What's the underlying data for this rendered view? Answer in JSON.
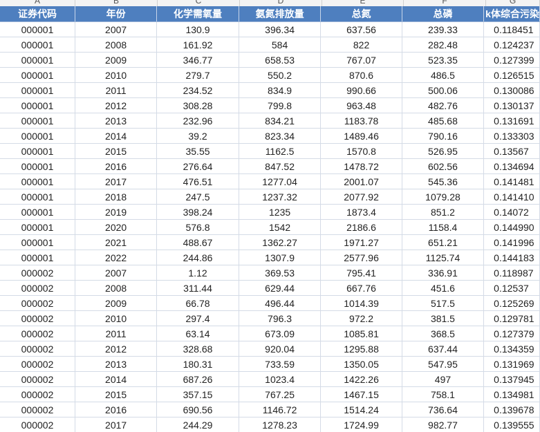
{
  "column_letters": [
    "A",
    "B",
    "C",
    "D",
    "E",
    "F",
    "G"
  ],
  "headers": [
    "证券代码",
    "年份",
    "化学需氧量",
    "氨氮排放量",
    "总氮",
    "总磷",
    "k体综合污染"
  ],
  "rows": [
    [
      "000001",
      "2007",
      "130.9",
      "396.34",
      "637.56",
      "239.33",
      "0.118451"
    ],
    [
      "000001",
      "2008",
      "161.92",
      "584",
      "822",
      "282.48",
      "0.124237"
    ],
    [
      "000001",
      "2009",
      "346.77",
      "658.53",
      "767.07",
      "523.35",
      "0.127399"
    ],
    [
      "000001",
      "2010",
      "279.7",
      "550.2",
      "870.6",
      "486.5",
      "0.126515"
    ],
    [
      "000001",
      "2011",
      "234.52",
      "834.9",
      "990.66",
      "500.06",
      "0.130086"
    ],
    [
      "000001",
      "2012",
      "308.28",
      "799.8",
      "963.48",
      "482.76",
      "0.130137"
    ],
    [
      "000001",
      "2013",
      "232.96",
      "834.21",
      "1183.78",
      "485.68",
      "0.131691"
    ],
    [
      "000001",
      "2014",
      "39.2",
      "823.34",
      "1489.46",
      "790.16",
      "0.133303"
    ],
    [
      "000001",
      "2015",
      "35.55",
      "1162.5",
      "1570.8",
      "526.95",
      "0.13567"
    ],
    [
      "000001",
      "2016",
      "276.64",
      "847.52",
      "1478.72",
      "602.56",
      "0.134694"
    ],
    [
      "000001",
      "2017",
      "476.51",
      "1277.04",
      "2001.07",
      "545.36",
      "0.141481"
    ],
    [
      "000001",
      "2018",
      "247.5",
      "1237.32",
      "2077.92",
      "1079.28",
      "0.141410"
    ],
    [
      "000001",
      "2019",
      "398.24",
      "1235",
      "1873.4",
      "851.2",
      "0.14072"
    ],
    [
      "000001",
      "2020",
      "576.8",
      "1542",
      "2186.6",
      "1158.4",
      "0.144990"
    ],
    [
      "000001",
      "2021",
      "488.67",
      "1362.27",
      "1971.27",
      "651.21",
      "0.141996"
    ],
    [
      "000001",
      "2022",
      "244.86",
      "1307.9",
      "2577.96",
      "1125.74",
      "0.144183"
    ],
    [
      "000002",
      "2007",
      "1.12",
      "369.53",
      "795.41",
      "336.91",
      "0.118987"
    ],
    [
      "000002",
      "2008",
      "311.44",
      "629.44",
      "667.76",
      "451.6",
      "0.12537"
    ],
    [
      "000002",
      "2009",
      "66.78",
      "496.44",
      "1014.39",
      "517.5",
      "0.125269"
    ],
    [
      "000002",
      "2010",
      "297.4",
      "796.3",
      "972.2",
      "381.5",
      "0.129781"
    ],
    [
      "000002",
      "2011",
      "63.14",
      "673.09",
      "1085.81",
      "368.5",
      "0.127379"
    ],
    [
      "000002",
      "2012",
      "328.68",
      "920.04",
      "1295.88",
      "637.44",
      "0.134359"
    ],
    [
      "000002",
      "2013",
      "180.31",
      "733.59",
      "1350.05",
      "547.95",
      "0.131969"
    ],
    [
      "000002",
      "2014",
      "687.26",
      "1023.4",
      "1422.26",
      "497",
      "0.137945"
    ],
    [
      "000002",
      "2015",
      "357.15",
      "767.25",
      "1467.15",
      "758.1",
      "0.134981"
    ],
    [
      "000002",
      "2016",
      "690.56",
      "1146.72",
      "1514.24",
      "736.64",
      "0.139678"
    ],
    [
      "000002",
      "2017",
      "244.29",
      "1278.23",
      "1724.99",
      "982.77",
      "0.139555"
    ]
  ]
}
